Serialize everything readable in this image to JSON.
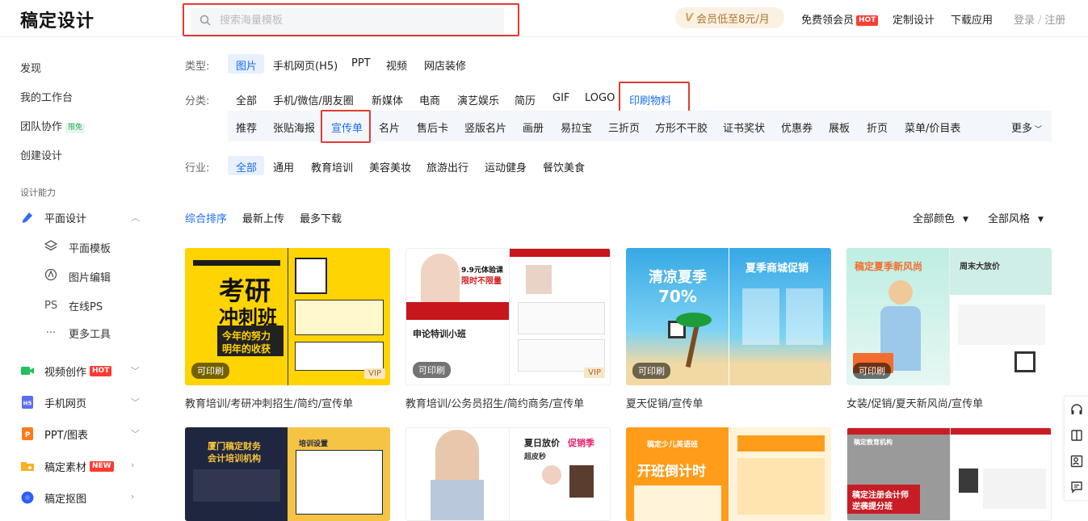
{
  "header": {
    "logo": "稿定设计",
    "search_placeholder": "搜索海量模板",
    "vip_text": "会员低至8元/月",
    "nav": [
      "免费领会员",
      "定制设计",
      "下载应用"
    ],
    "hot": "HOT",
    "login": "登录",
    "register": "注册",
    "login_sep": "/"
  },
  "sidebar": {
    "links": [
      "发现",
      "我的工作台",
      "团队协作",
      "创建设计"
    ],
    "limit_badge": "限免",
    "section": "设计能力",
    "menu": {
      "flat": "平面设计",
      "sub": [
        "平面模板",
        "图片编辑",
        "在线PS",
        "更多工具"
      ],
      "ps_icon": "PS",
      "video": "视频创作",
      "video_badge": "HOT",
      "h5": "手机网页",
      "ppt": "PPT/图表",
      "assets": "稿定素材",
      "assets_badge": "NEW",
      "cutout": "稿定抠图"
    }
  },
  "filters": {
    "type_label": "类型:",
    "types": [
      "图片",
      "手机网页(H5)",
      "PPT",
      "视频",
      "网店装修"
    ],
    "cat_label": "分类:",
    "cats": [
      "全部",
      "手机/微信/朋友圈",
      "新媒体",
      "电商",
      "演艺娱乐",
      "简历",
      "GIF",
      "LOGO",
      "印刷物料"
    ],
    "subcats": [
      "推荐",
      "张贴海报",
      "宣传单",
      "名片",
      "售后卡",
      "竖版名片",
      "画册",
      "易拉宝",
      "三折页",
      "方形不干胶",
      "证书奖状",
      "优惠券",
      "展板",
      "折页",
      "菜单/价目表"
    ],
    "more": "更多",
    "industry_label": "行业:",
    "industries": [
      "全部",
      "通用",
      "教育培训",
      "美容美妆",
      "旅游出行",
      "运动健身",
      "餐饮美食"
    ]
  },
  "sort": {
    "items": [
      "综合排序",
      "最新上传",
      "最多下载"
    ],
    "color": "全部颜色",
    "style": "全部风格"
  },
  "cards": [
    {
      "title": "教育培训/考研冲刺招生/简约/宣传单",
      "badge": "可印刷",
      "vip": "VIP",
      "p1": "考研",
      "p2": "冲刺班",
      "p3": "今年的努力",
      "p4": "明年的收获"
    },
    {
      "title": "教育培训/公务员招生/简约商务/宣传单",
      "badge": "可印刷",
      "vip": "VIP",
      "p1": "9.9元体验课",
      "p2": "限时不限量",
      "p3": "申论特训小班"
    },
    {
      "title": "夏天促销/宣传单",
      "badge": "可印刷",
      "p1": "清凉夏季",
      "p2": "70%",
      "p3": "夏季商城促销"
    },
    {
      "title": "女装/促销/夏天新风尚/宣传单",
      "badge": "可印刷",
      "p1": "稿定夏季新风尚",
      "p2": "周末大放价"
    },
    {
      "p1": "厦门稿定财务",
      "p2": "会计培训机构",
      "p3": "培训设置"
    },
    {
      "p1": "夏日放价",
      "p2": "促销季",
      "p3": "超皮秒"
    },
    {
      "p1": "稿定少儿英语班",
      "p2": "开班倒计时"
    },
    {
      "p1": "稿定注册会计师",
      "p2": "逆袭提分班",
      "p3": "稿定教育机构"
    }
  ],
  "colors": {
    "accent": "#1a6cf3",
    "highlight": "#e53935",
    "hot": "#ff3b30"
  }
}
